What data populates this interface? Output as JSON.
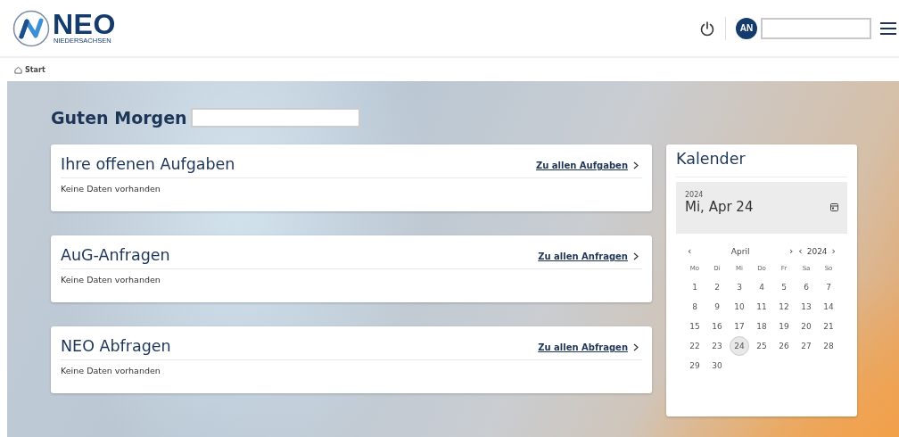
{
  "header": {
    "logo": {
      "name": "NEO",
      "subtitle": "NIEDERSACHSEN"
    },
    "avatar": "AN"
  },
  "breadcrumb": {
    "label": "Start"
  },
  "greeting": "Guten Morgen",
  "panels": [
    {
      "title": "Ihre offenen Aufgaben",
      "link": "Zu allen Aufgaben",
      "empty": "Keine Daten vorhanden"
    },
    {
      "title": "AuG-Anfragen",
      "link": "Zu allen Anfragen",
      "empty": "Keine Daten vorhanden"
    },
    {
      "title": "NEO Abfragen",
      "link": "Zu allen Abfragen",
      "empty": "Keine Daten vorhanden"
    }
  ],
  "calendar": {
    "title": "Kalender",
    "year": "2024",
    "date": "Mi, Apr 24",
    "month": "April",
    "month_year": "2024",
    "prev": "‹",
    "next": "›",
    "weekdays": [
      "Mo",
      "Di",
      "Mi",
      "Do",
      "Fr",
      "Sa",
      "So"
    ],
    "days": [
      {
        "label": "1",
        "selected": false
      },
      {
        "label": "2",
        "selected": false
      },
      {
        "label": "3",
        "selected": false
      },
      {
        "label": "4",
        "selected": false
      },
      {
        "label": "5",
        "selected": false
      },
      {
        "label": "6",
        "selected": false
      },
      {
        "label": "7",
        "selected": false
      },
      {
        "label": "8",
        "selected": false
      },
      {
        "label": "9",
        "selected": false
      },
      {
        "label": "10",
        "selected": false
      },
      {
        "label": "11",
        "selected": false
      },
      {
        "label": "12",
        "selected": false
      },
      {
        "label": "13",
        "selected": false
      },
      {
        "label": "14",
        "selected": false
      },
      {
        "label": "15",
        "selected": false
      },
      {
        "label": "16",
        "selected": false
      },
      {
        "label": "17",
        "selected": false
      },
      {
        "label": "18",
        "selected": false
      },
      {
        "label": "19",
        "selected": false
      },
      {
        "label": "20",
        "selected": false
      },
      {
        "label": "21",
        "selected": false
      },
      {
        "label": "22",
        "selected": false
      },
      {
        "label": "23",
        "selected": false
      },
      {
        "label": "24",
        "selected": true
      },
      {
        "label": "25",
        "selected": false
      },
      {
        "label": "26",
        "selected": false
      },
      {
        "label": "27",
        "selected": false
      },
      {
        "label": "28",
        "selected": false
      },
      {
        "label": "29",
        "selected": false
      },
      {
        "label": "30",
        "selected": false
      }
    ]
  }
}
